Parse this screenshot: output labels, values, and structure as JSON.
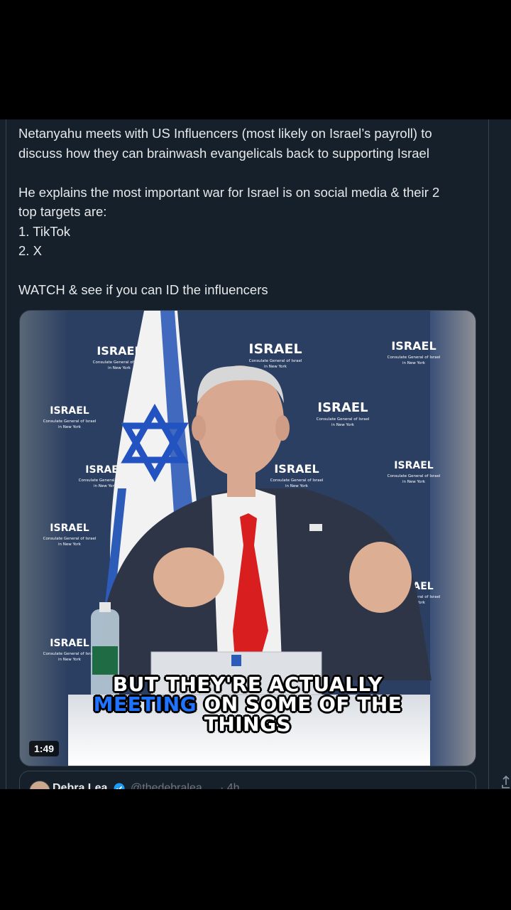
{
  "tweet": {
    "lines_para1": [
      "Netanyahu meets with US Influencers (most likely on Israel’s payroll) to",
      "discuss how they can brainwash evangelicals back to supporting Israel"
    ],
    "lines_para2": [
      "He explains the most important war for Israel is on social media & their 2",
      "top targets are:",
      "1. TikTok",
      "2. X"
    ],
    "para3": "WATCH & see if you can ID the influencers"
  },
  "video": {
    "backdrop_word": "ISRAEL",
    "backdrop_sub1": "Consulate General of Israel",
    "backdrop_sub2": "in New York",
    "caption_line1": "BUT THEY'RE ACTUALLY",
    "caption_highlight": "MEETING",
    "caption_line2_rest": " ON SOME OF THE",
    "caption_line3": "THINGS",
    "duration": "1:49",
    "colors": {
      "caption_highlight": "#1e73ff",
      "backdrop": "#2b3f62",
      "tie": "#d81e1e"
    }
  },
  "quote": {
    "name": "Debra Lea",
    "handle": "@thedebralea",
    "time": "· 4h"
  },
  "icons": [
    "verified-badge-icon",
    "share-icon"
  ]
}
